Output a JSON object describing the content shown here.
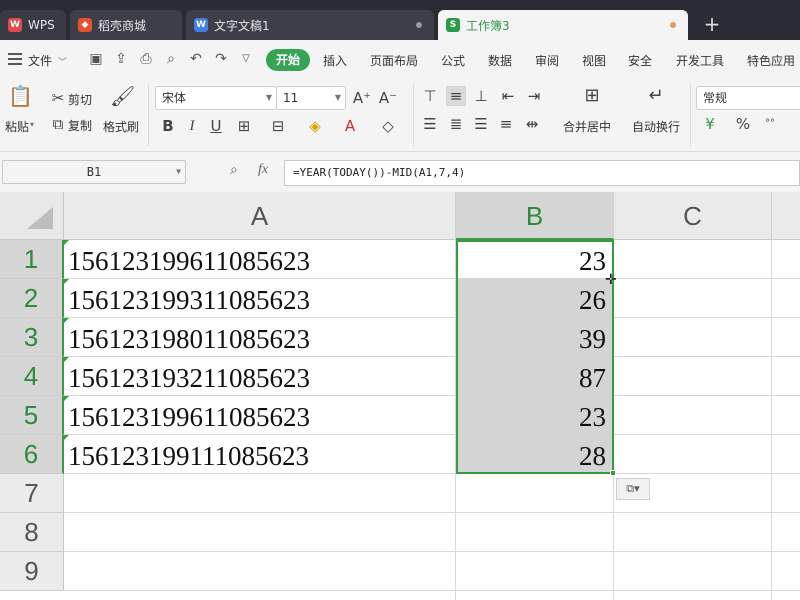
{
  "tabs": [
    {
      "label": "WPS",
      "icon": "wps-logo-icon"
    },
    {
      "label": "稻壳商城",
      "icon": "daoke-icon"
    },
    {
      "label": "文字文稿1",
      "icon": "writer-doc-icon"
    },
    {
      "label": "工作簿3",
      "icon": "spreadsheet-icon",
      "active": true
    }
  ],
  "menu": {
    "file": "文件",
    "items": [
      "开始",
      "插入",
      "页面布局",
      "公式",
      "数据",
      "审阅",
      "视图",
      "安全",
      "开发工具",
      "特色应用"
    ],
    "active": "开始"
  },
  "ribbon": {
    "paste": "粘贴",
    "cut": "剪切",
    "copy": "复制",
    "format_painter": "格式刷",
    "font_name": "宋体",
    "font_size": "11",
    "merge_center": "合并居中",
    "wrap_text": "自动换行",
    "number_format": "常规",
    "percent": "%"
  },
  "formula_bar": {
    "name_box": "B1",
    "fx": "fx",
    "formula": "=YEAR(TODAY())-MID(A1,7,4)"
  },
  "sheet": {
    "columns": [
      "A",
      "B",
      "C"
    ],
    "selected_column": "B",
    "rows": [
      {
        "row": "1",
        "a": "156123199611085623",
        "b": "23"
      },
      {
        "row": "2",
        "a": "156123199311085623",
        "b": "26"
      },
      {
        "row": "3",
        "a": "156123198011085623",
        "b": "39"
      },
      {
        "row": "4",
        "a": "156123193211085623",
        "b": "87"
      },
      {
        "row": "5",
        "a": "156123199611085623",
        "b": "23"
      },
      {
        "row": "6",
        "a": "156123199111085623",
        "b": "28"
      },
      {
        "row": "7",
        "a": "",
        "b": ""
      },
      {
        "row": "8",
        "a": "",
        "b": ""
      },
      {
        "row": "9",
        "a": "",
        "b": ""
      }
    ]
  },
  "colors": {
    "accent_green": "#3a9b45",
    "tab_bar": "#2b2b33",
    "start_button": "#36a356"
  }
}
